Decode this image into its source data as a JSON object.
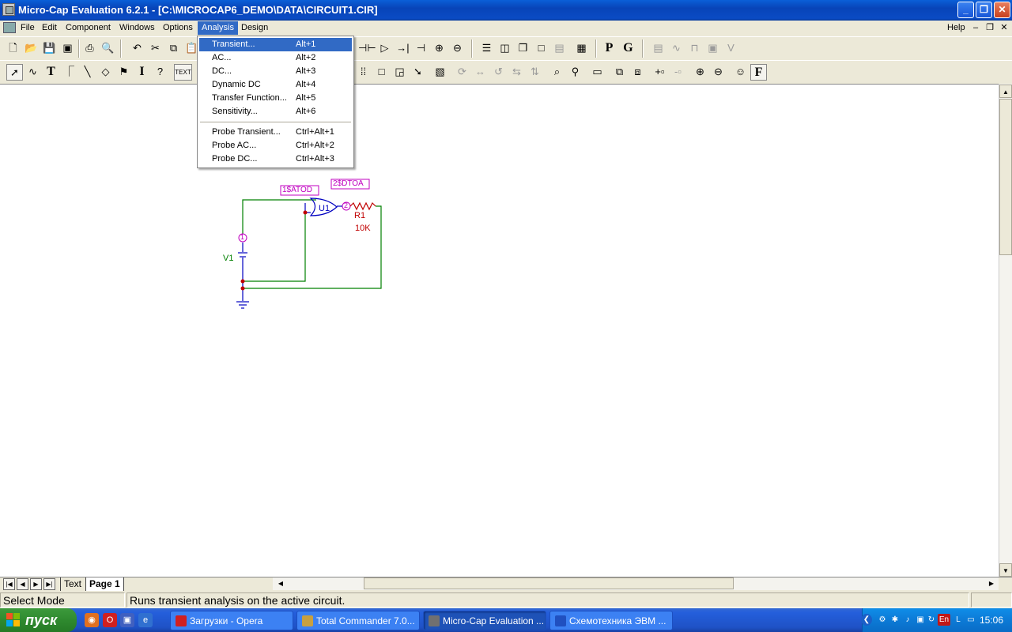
{
  "window": {
    "title": "Micro-Cap Evaluation 6.2.1 - [C:\\MICROCAP6_DEMO\\DATA\\CIRCUIT1.CIR]",
    "minimize": "_",
    "restore": "❐",
    "close": "✕"
  },
  "menubar": {
    "items": [
      "File",
      "Edit",
      "Component",
      "Windows",
      "Options",
      "Analysis",
      "Design"
    ],
    "active": "Analysis",
    "help": "Help",
    "mdi_minimize": "–",
    "mdi_restore": "❐",
    "mdi_close": "✕"
  },
  "analysis_menu": {
    "items": [
      {
        "label": "Transient...",
        "shortcut": "Alt+1"
      },
      {
        "label": "AC...",
        "shortcut": "Alt+2"
      },
      {
        "label": "DC...",
        "shortcut": "Alt+3"
      },
      {
        "label": "Dynamic DC",
        "shortcut": "Alt+4"
      },
      {
        "label": "Transfer Function...",
        "shortcut": "Alt+5"
      },
      {
        "label": "Sensitivity...",
        "shortcut": "Alt+6"
      },
      {
        "label": "Probe Transient...",
        "shortcut": "Ctrl+Alt+1"
      },
      {
        "label": "Probe AC...",
        "shortcut": "Ctrl+Alt+2"
      },
      {
        "label": "Probe DC...",
        "shortcut": "Ctrl+Alt+3"
      }
    ],
    "highlighted": "Transient..."
  },
  "toolbar1": {
    "p_button": "P",
    "g_button": "G"
  },
  "toolbar2": {
    "text_button": "TEXT",
    "f_button": "F"
  },
  "schematic": {
    "atod_label": "1$ATOD",
    "dtoa_label": "2$DTOA",
    "gate_name": "U1",
    "resistor_name": "R1",
    "resistor_value": "10K",
    "source_name": "V1",
    "node1": "1",
    "node2": "2",
    "colors": {
      "wire": "#008000",
      "component": "#0000c0",
      "label": "#c000c0",
      "resistor": "#c00000",
      "node": "#c00000"
    }
  },
  "tabs": {
    "items": [
      "Text",
      "Page 1"
    ],
    "selected": "Page 1"
  },
  "statusbar": {
    "mode": "Select Mode",
    "message": "Runs transient analysis on the active circuit."
  },
  "taskbar": {
    "start_label": "пуск",
    "tasks": [
      {
        "label": "Загрузки - Opera",
        "color": "#d02020"
      },
      {
        "label": "Total Commander 7.0...",
        "color": "#c8a040"
      },
      {
        "label": "Micro-Cap Evaluation ...",
        "color": "#707070"
      },
      {
        "label": "Схемотехника ЭВМ ...",
        "color": "#2050c0"
      }
    ],
    "active_task": "Micro-Cap Evaluation ...",
    "language": "En",
    "clock": "15:06"
  }
}
